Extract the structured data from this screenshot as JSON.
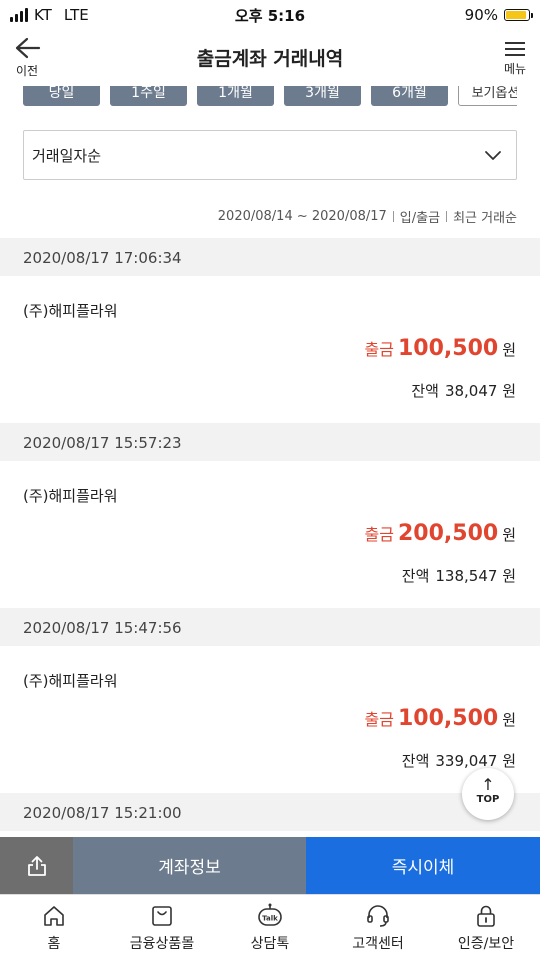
{
  "status": {
    "carrier": "KT",
    "network": "LTE",
    "time": "오후 5:16",
    "battery": "90%",
    "battery_level": 0.9
  },
  "header": {
    "back_label": "이전",
    "title": "출금계좌 거래내역",
    "menu_label": "메뉴"
  },
  "periods": [
    "당일",
    "1주일",
    "1개월",
    "3개월",
    "6개월"
  ],
  "view_options_label": "보기옵션",
  "sort": {
    "selected": "거래일자순"
  },
  "range_info": {
    "dates": "2020/08/14 ~ 2020/08/17",
    "type": "입/출금",
    "order": "최근 거래순"
  },
  "transactions": [
    {
      "datetime": "2020/08/17 17:06:34",
      "name": "(주)해피플라워",
      "type": "출금",
      "amount": "100,500",
      "currency": "원",
      "balance_label": "잔액",
      "balance": "38,047 원"
    },
    {
      "datetime": "2020/08/17 15:57:23",
      "name": "(주)해피플라워",
      "type": "출금",
      "amount": "200,500",
      "currency": "원",
      "balance_label": "잔액",
      "balance": "138,547 원"
    },
    {
      "datetime": "2020/08/17 15:47:56",
      "name": "(주)해피플라워",
      "type": "출금",
      "amount": "100,500",
      "currency": "원",
      "balance_label": "잔액",
      "balance": "339,047 원"
    },
    {
      "datetime": "2020/08/17 15:21:00"
    }
  ],
  "top_button": {
    "label": "TOP"
  },
  "actions": {
    "account_info": "계좌정보",
    "instant_transfer": "즉시이체"
  },
  "tabs": [
    {
      "label": "홈",
      "icon": "home-icon"
    },
    {
      "label": "금융상품몰",
      "icon": "shopping-bag-icon"
    },
    {
      "label": "상담톡",
      "icon": "talk-bot-icon"
    },
    {
      "label": "고객센터",
      "icon": "headset-icon"
    },
    {
      "label": "인증/보안",
      "icon": "lock-icon"
    }
  ],
  "colors": {
    "primary": "#1a6ee0",
    "slate": "#6c7b8e",
    "withdraw": "#e0452f"
  }
}
